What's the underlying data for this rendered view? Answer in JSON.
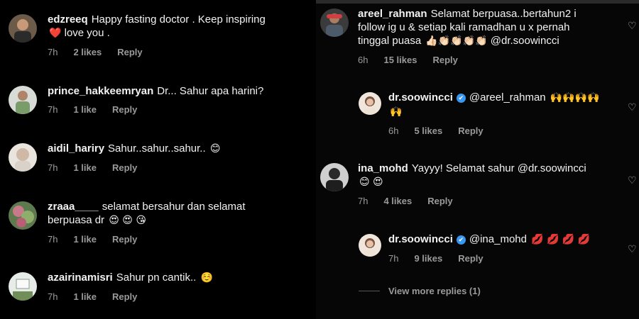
{
  "left_comments": [
    {
      "username": "edzreeq",
      "text": "Happy fasting doctor . Keep inspiring",
      "text2": "love you .",
      "emoji": "❤️",
      "time": "7h",
      "likes": "2 likes",
      "reply": "Reply"
    },
    {
      "username": "prince_hakkeemryan",
      "text": "Dr... Sahur apa harini?",
      "time": "7h",
      "likes": "1 like",
      "reply": "Reply"
    },
    {
      "username": "aidil_hariry",
      "text": "Sahur..sahur..sahur..",
      "emoji": "😊",
      "time": "7h",
      "likes": "1 like",
      "reply": "Reply"
    },
    {
      "username": "zraaa____",
      "text": "selamat bersahur dan selamat",
      "text2": "berpuasa dr",
      "emoji": "😍 😍 😘",
      "time": "7h",
      "likes": "1 like",
      "reply": "Reply"
    },
    {
      "username": "azairinamisri",
      "text": "Sahur pn cantik..",
      "emoji": "☺️",
      "time": "7h",
      "likes": "1 like",
      "reply": "Reply"
    }
  ],
  "right_comments": [
    {
      "username": "areel_rahman",
      "text": "Selamat berpuasa..bertahun2 i",
      "text2": "follow ig u & setiap kali ramadhan u x pernah",
      "text3": "tinggal puasa",
      "emoji": "👍🏻👏🏻👏🏻👏🏻👏🏻",
      "mention": "@dr.soowincci",
      "time": "6h",
      "likes": "15 likes",
      "reply": "Reply"
    },
    {
      "username": "dr.soowincci",
      "verified": "✔",
      "mention": "@areel_rahman",
      "emoji": "🙌🙌🙌🙌",
      "emoji2": "🙌",
      "time": "6h",
      "likes": "5 likes",
      "reply": "Reply"
    },
    {
      "username": "ina_mohd",
      "text": "Yayyy! Selamat sahur @dr.soowincci",
      "emoji": "😊 😍",
      "time": "7h",
      "likes": "4 likes",
      "reply": "Reply"
    },
    {
      "username": "dr.soowincci",
      "verified": "✔",
      "mention": "@ina_mohd",
      "emoji": "💋 💋 💋 💋",
      "time": "7h",
      "likes": "9 likes",
      "reply": "Reply"
    }
  ],
  "view_more": "View more replies (1)",
  "icons": {
    "heart": "heart-outline-icon"
  },
  "colors": {
    "background": "#000000",
    "text": "#f2f2f2",
    "meta": "#9a9a9a",
    "verified": "#3897f0"
  }
}
